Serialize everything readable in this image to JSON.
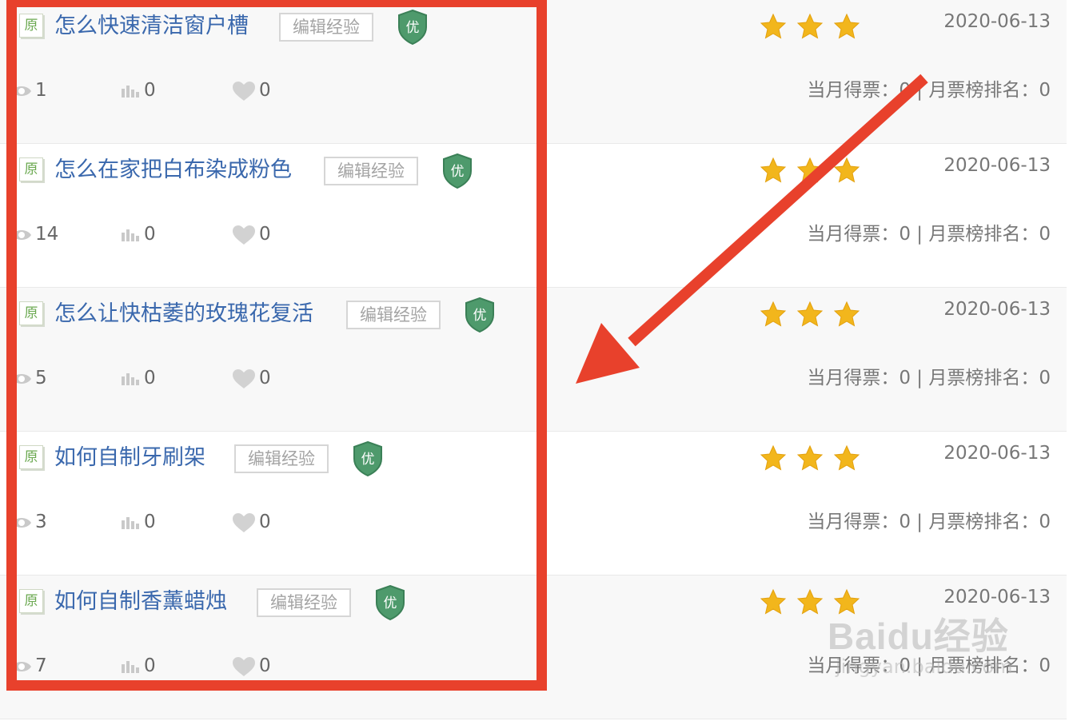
{
  "items": [
    {
      "original_badge": "原",
      "title": "怎么快速清洁窗户槽",
      "edit_label": "编辑经验",
      "quality_badge": "优",
      "rating": 3,
      "date": "2020-06-13",
      "views": "1",
      "votes": "0",
      "likes": "0",
      "monthly_votes_label": "当月得票：",
      "monthly_votes": "0",
      "rank_label": "月票榜排名：",
      "rank": "0"
    },
    {
      "original_badge": "原",
      "title": "怎么在家把白布染成粉色",
      "edit_label": "编辑经验",
      "quality_badge": "优",
      "rating": 3,
      "date": "2020-06-13",
      "views": "14",
      "votes": "0",
      "likes": "0",
      "monthly_votes_label": "当月得票：",
      "monthly_votes": "0",
      "rank_label": "月票榜排名：",
      "rank": "0"
    },
    {
      "original_badge": "原",
      "title": "怎么让快枯萎的玫瑰花复活",
      "edit_label": "编辑经验",
      "quality_badge": "优",
      "rating": 3,
      "date": "2020-06-13",
      "views": "5",
      "votes": "0",
      "likes": "0",
      "monthly_votes_label": "当月得票：",
      "monthly_votes": "0",
      "rank_label": "月票榜排名：",
      "rank": "0"
    },
    {
      "original_badge": "原",
      "title": "如何自制牙刷架",
      "edit_label": "编辑经验",
      "quality_badge": "优",
      "rating": 3,
      "date": "2020-06-13",
      "views": "3",
      "votes": "0",
      "likes": "0",
      "monthly_votes_label": "当月得票：",
      "monthly_votes": "0",
      "rank_label": "月票榜排名：",
      "rank": "0"
    },
    {
      "original_badge": "原",
      "title": "如何自制香薰蜡烛",
      "edit_label": "编辑经验",
      "quality_badge": "优",
      "rating": 3,
      "date": "2020-06-13",
      "views": "7",
      "votes": "0",
      "likes": "0",
      "monthly_votes_label": "当月得票：",
      "monthly_votes": "0",
      "rank_label": "月票榜排名：",
      "rank": "0"
    }
  ],
  "colors": {
    "title": "#3a68ad",
    "annotation": "#e8412c",
    "badge": "#4e9a6c",
    "star": "#f2b61c"
  },
  "watermark": {
    "brand": "Baidu经验",
    "url": "jingyan.baidu.com"
  },
  "icons": {
    "views": "eye-icon",
    "votes": "bar-chart-icon",
    "likes": "heart-icon",
    "quality": "shield-badge-icon",
    "rating": "star-icon"
  }
}
